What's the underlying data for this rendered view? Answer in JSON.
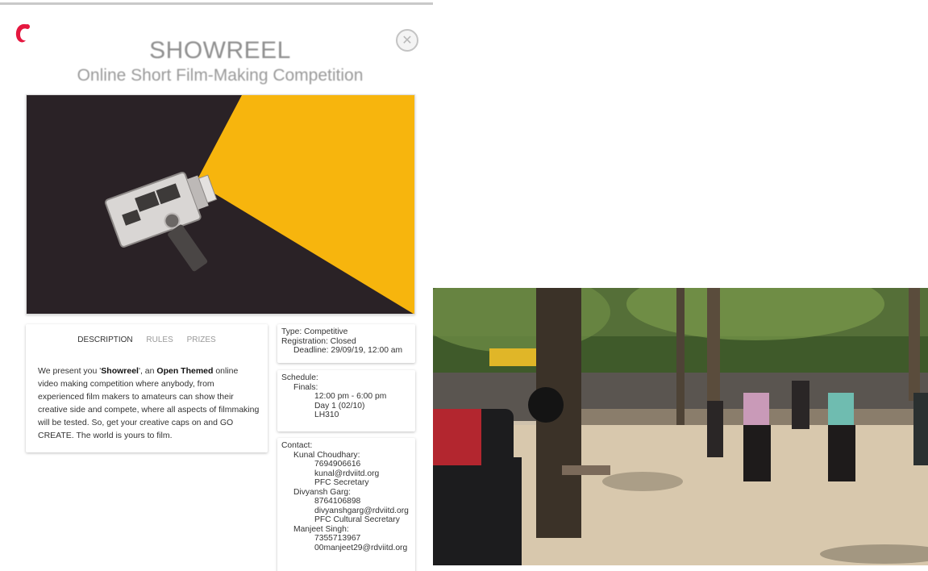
{
  "modal": {
    "title": "SHOWREEL",
    "subtitle": "Online Short Film-Making Competition",
    "close_icon": "close-circle-icon",
    "logo_icon": "brand-logo-icon",
    "colors": {
      "accent": "#e5173f",
      "banner_yellow": "#f6b20a",
      "banner_dark": "#2a2226"
    }
  },
  "tabs": [
    {
      "label": "DESCRIPTION",
      "active": true
    },
    {
      "label": "RULES",
      "active": false
    },
    {
      "label": "PRIZES",
      "active": false
    }
  ],
  "description": {
    "p1": "We present you '",
    "b1": "Showreel",
    "p2": "', an ",
    "b2": "Open Themed",
    "p3": " online video making competition where anybody, from experienced film makers to amateurs can show their creative side and compete, where all aspects of filmmaking will be tested. So, get your creative caps on and GO CREATE. The world is yours to film."
  },
  "event_info": {
    "type": "Type: Competitive",
    "registration": "Registration: Closed",
    "deadline": "Deadline: 29/09/19, 12:00 am"
  },
  "schedule": {
    "heading": "Schedule:",
    "round": "Finals:",
    "time": "12:00 pm - 6:00 pm",
    "day": "Day 1 (02/10)",
    "venue": "LH310"
  },
  "contact": {
    "heading": "Contact:",
    "people": [
      {
        "name": "Kunal Choudhary:",
        "phone": "7694906616",
        "email": "kunal@rdviitd.org",
        "role": "PFC Secretary"
      },
      {
        "name": "Divyansh Garg:",
        "phone": "8764106898",
        "email": "divyanshgarg@rdviitd.org",
        "role": "PFC Cultural Secretary"
      },
      {
        "name": "Manjeet Singh:",
        "phone": "7355713967",
        "email": "00manjeet29@rdviitd.org",
        "role": ""
      }
    ]
  }
}
